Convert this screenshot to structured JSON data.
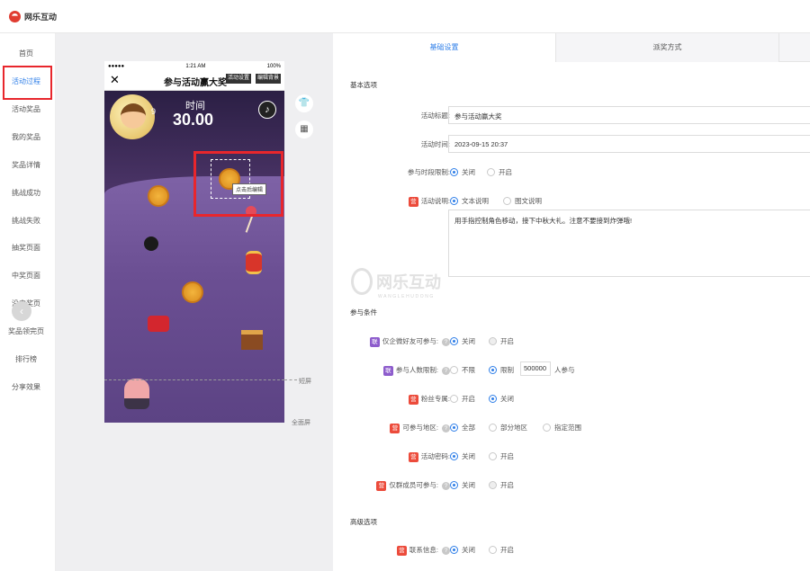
{
  "brand": {
    "name": "网乐互动"
  },
  "sidebar": {
    "items": [
      {
        "label": "首页"
      },
      {
        "label": "活动过程"
      },
      {
        "label": "活动奖品"
      },
      {
        "label": "我的奖品"
      },
      {
        "label": "奖品详情"
      },
      {
        "label": "挑战成功"
      },
      {
        "label": "挑战失败"
      },
      {
        "label": "抽奖页面"
      },
      {
        "label": "中奖页面"
      },
      {
        "label": "没中奖页"
      },
      {
        "label": "奖品领完页"
      },
      {
        "label": "排行榜"
      },
      {
        "label": "分享效果"
      }
    ],
    "collapse_symbol": "«",
    "back_symbol": "‹"
  },
  "preview": {
    "status": {
      "signal": "●●●●●",
      "time": "1:21 AM",
      "battery": "100%"
    },
    "nav": {
      "close": "✕",
      "title": "参与活动赢大奖",
      "btn_settings": "活动设置",
      "btn_bg": "编辑背景"
    },
    "game": {
      "time_label": "时间",
      "time_value": "30.00",
      "lives": "9"
    },
    "tooltip": "点击后编辑",
    "short_screen": "短屏",
    "full_screen": "全面屏",
    "tools": {
      "shirt": "👕",
      "grid": "▦"
    }
  },
  "tabs": [
    {
      "label": "基础设置",
      "active": true
    },
    {
      "label": "派奖方式",
      "active": false
    }
  ],
  "basic": {
    "section": "基本选项",
    "title": {
      "label": "活动标题:",
      "value": "参与活动赢大奖"
    },
    "time": {
      "label": "活动时间:",
      "value": "2023-09-15 20:37"
    },
    "period": {
      "label": "参与时段限制:",
      "off": "关闭",
      "on": "开启"
    },
    "desc": {
      "badge": "营",
      "label": "活动说明:",
      "opt1": "文本说明",
      "opt2": "图文说明",
      "text": "用手指控制角色移动，接下中秋大礼。注意不要接到炸弹哦!"
    }
  },
  "conditions": {
    "section": "参与条件",
    "wechat_friend": {
      "badge": "联",
      "label": "仅企微好友可参与:",
      "help": "?",
      "off": "关闭",
      "on": "开启"
    },
    "limit": {
      "badge": "联",
      "label": "参与人数限制:",
      "help": "?",
      "opt1": "不限",
      "opt2": "限制",
      "count": "500000",
      "suffix": "人参与"
    },
    "fans": {
      "badge": "营",
      "label": "粉丝专属:",
      "on": "开启",
      "off": "关闭"
    },
    "region": {
      "badge": "营",
      "label": "可参与地区:",
      "help": "?",
      "opt1": "全部",
      "opt2": "部分地区",
      "opt3": "指定范围"
    },
    "password": {
      "badge": "营",
      "label": "活动密码:",
      "off": "关闭",
      "on": "开启"
    },
    "group": {
      "badge": "营",
      "label": "仅群成员可参与:",
      "help": "?",
      "off": "关闭",
      "on": "开启"
    }
  },
  "advanced": {
    "section": "高级选项",
    "contact": {
      "badge": "营",
      "label": "联系信息:",
      "help": "?",
      "off": "关闭",
      "on": "开启"
    }
  },
  "watermark": {
    "text": "网乐互动",
    "sub": "WANGLEHUDONG"
  },
  "colors": {
    "accent": "#2f7fe8",
    "highlight": "#e8262c",
    "badge_red": "#ec4b3b",
    "badge_purple": "#8d5ccc"
  }
}
